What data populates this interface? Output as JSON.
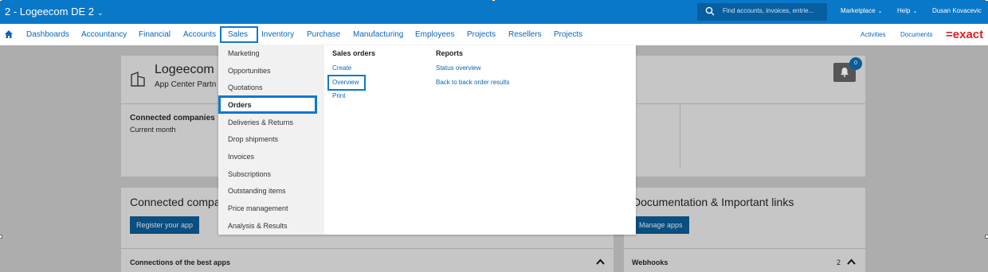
{
  "topbar": {
    "company": "2 - Logeecom DE 2",
    "search_placeholder": "Find accounts, invoices, entrie...",
    "marketplace": "Marketplace",
    "help": "Help",
    "user": "Dusan Kovacevic"
  },
  "nav": {
    "items": [
      "Dashboards",
      "Accountancy",
      "Financial",
      "Accounts",
      "Sales",
      "Inventory",
      "Purchase",
      "Manufacturing",
      "Employees",
      "Projects",
      "Resellers",
      "Projects"
    ],
    "activities": "Activities",
    "documents": "Documents",
    "logo": "=exact"
  },
  "background": {
    "company_name": "Logeecom",
    "partner": "App Center Partn",
    "connected_companies": "Connected companies",
    "current_month": "Current month",
    "connected_panel_title": "Connected compan",
    "register_button": "Register your app",
    "doc_title": "Documentation & Important links",
    "manage_button": "Manage apps",
    "best_apps": "Connections of the best apps",
    "webhooks": "Webhooks",
    "webhooks_count": "2",
    "notification_count": "0"
  },
  "menu": {
    "left_items": [
      "Marketing",
      "Opportunities",
      "Quotations",
      "Orders",
      "Deliveries & Returns",
      "Drop shipments",
      "Invoices",
      "Subscriptions",
      "Outstanding items",
      "Price management",
      "Analysis & Results"
    ],
    "sales_orders": {
      "title": "Sales orders",
      "links": [
        "Create",
        "Overview",
        "Print"
      ]
    },
    "reports": {
      "title": "Reports",
      "links": [
        "Status overview",
        "Back to back order results"
      ]
    }
  },
  "colors": {
    "brand_blue": "#0a78c8",
    "link_blue": "#0a66b8",
    "highlight": "#0a78d0",
    "logo_red": "#e01e24"
  }
}
